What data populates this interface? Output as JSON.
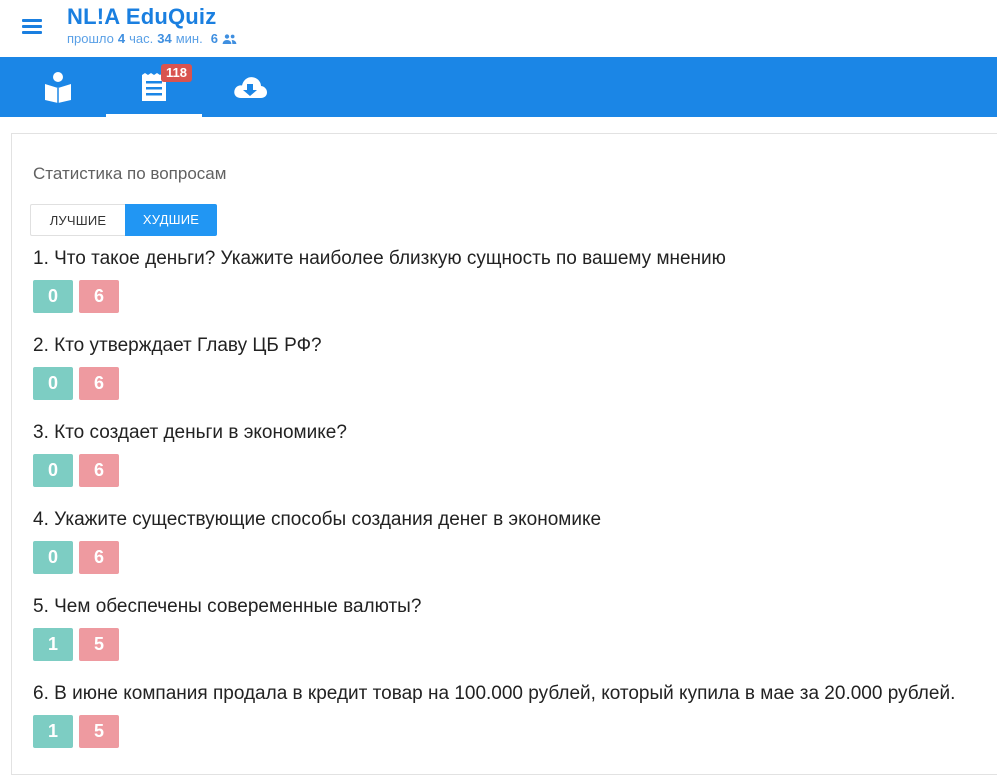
{
  "header": {
    "title": "NL!A EduQuiz",
    "elapsed_prefix": "прошло",
    "hours": "4",
    "hours_unit": "час.",
    "minutes": "34",
    "minutes_unit": "мин.",
    "participants": "6"
  },
  "tabs": [
    {
      "icon": "reader-icon",
      "active": false
    },
    {
      "icon": "list-icon",
      "active": true,
      "badge": "118"
    },
    {
      "icon": "cloud-download-icon",
      "active": false
    }
  ],
  "section_title": "Статистика по вопросам",
  "toggle": {
    "best_label": "Лучшие",
    "worst_label": "Худшие",
    "selected": "worst"
  },
  "questions": [
    {
      "text": "1. Что такое деньги? Укажите наиболее близкую сущность по вашему мнению",
      "correct": "0",
      "wrong": "6"
    },
    {
      "text": "2. Кто утверждает Главу ЦБ РФ?",
      "correct": "0",
      "wrong": "6"
    },
    {
      "text": "3. Кто создает деньги в экономике?",
      "correct": "0",
      "wrong": "6"
    },
    {
      "text": "4. Укажите существующие способы создания денег в экономике",
      "correct": "0",
      "wrong": "6"
    },
    {
      "text": "5. Чем обеспечены совеременные валюты?",
      "correct": "1",
      "wrong": "5"
    },
    {
      "text": "6. В июне компания продала в кредит товар на 100.000 рублей, который купила в мае за 20.000 рублей.",
      "correct": "1",
      "wrong": "5"
    }
  ],
  "colors": {
    "primary": "#1b86e6",
    "correct": "#7dcdc3",
    "wrong": "#ee9aa0",
    "badge": "#d9534f"
  }
}
